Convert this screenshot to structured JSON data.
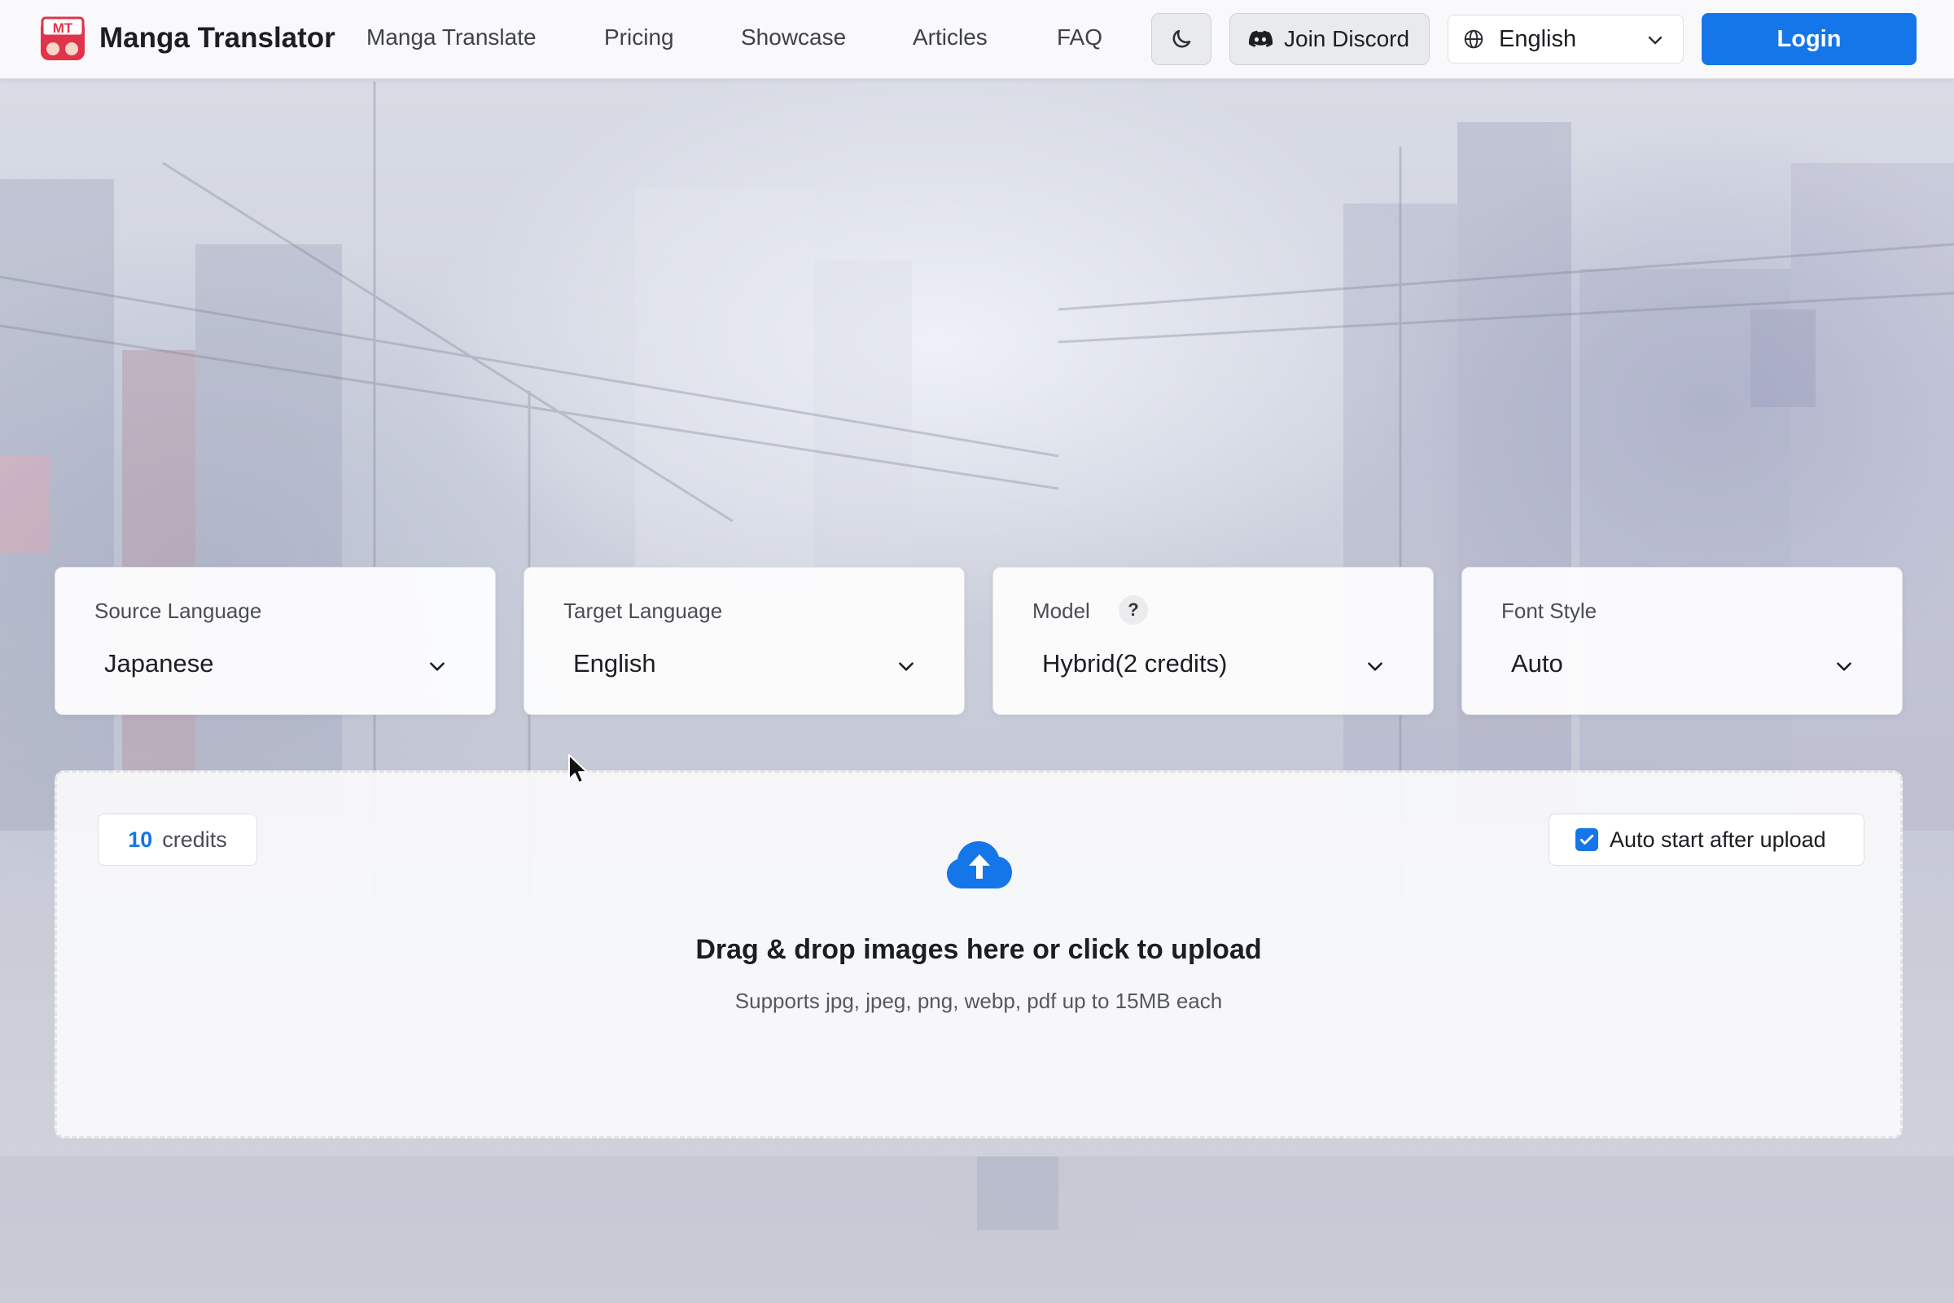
{
  "brand": {
    "name": "Manga Translator",
    "logo_text": "MT"
  },
  "nav": {
    "links": [
      "Manga Translate",
      "Pricing",
      "Showcase",
      "Articles",
      "FAQ"
    ],
    "discord_label": "Join Discord",
    "language": "English",
    "login_label": "Login"
  },
  "settings": {
    "source_language": {
      "label": "Source Language",
      "value": "Japanese"
    },
    "target_language": {
      "label": "Target Language",
      "value": "English"
    },
    "model": {
      "label": "Model",
      "value": "Hybrid(2 credits)",
      "help": "?"
    },
    "font_style": {
      "label": "Font Style",
      "value": "Auto"
    }
  },
  "upload": {
    "credits_count": "10",
    "credits_label": "credits",
    "auto_start_label": "Auto start after upload",
    "auto_start_checked": true,
    "title": "Drag & drop images here or click to upload",
    "subtitle": "Supports jpg, jpeg, png, webp, pdf up to 15MB each"
  },
  "colors": {
    "accent": "#1476e8",
    "logo_red": "#e0344a"
  },
  "icons": {
    "theme": "moon-icon",
    "discord": "discord-icon",
    "language": "globe-icon",
    "dropdown": "chevron-down-icon",
    "upload": "cloud-upload-icon",
    "checkbox": "checkmark-icon"
  }
}
